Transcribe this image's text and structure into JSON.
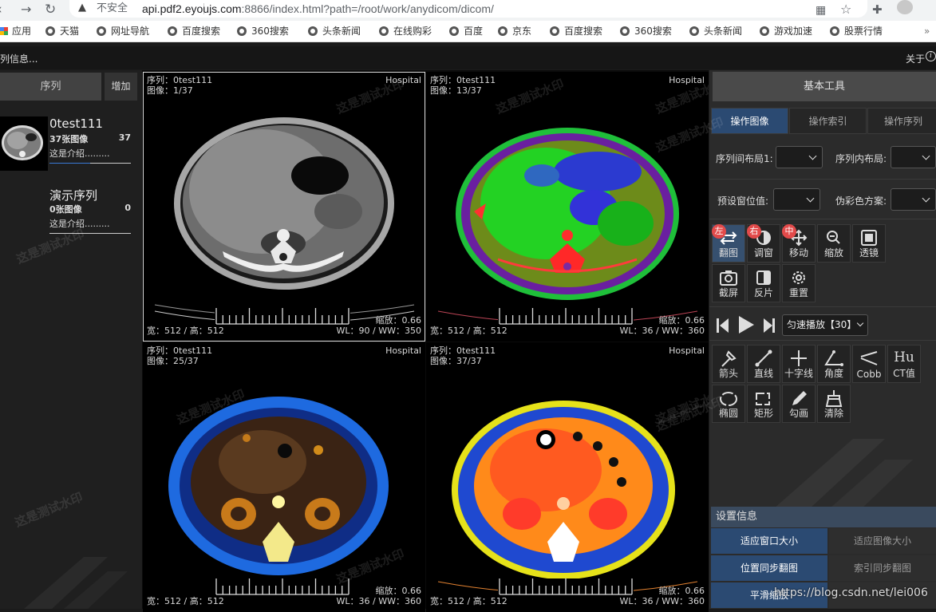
{
  "browser": {
    "security": "不安全",
    "url_host": "api.pdf2.eyoujs.com",
    "url_rest": ":8866/index.html?path=/root/work/anydicom/dicom/",
    "bookmarks": [
      "应用",
      "天猫",
      "网址导航",
      "百度搜索",
      "360搜索",
      "头条新闻",
      "在线购彩",
      "百度",
      "京东",
      "百度搜索",
      "360搜索",
      "头条新闻",
      "游戏加速",
      "股票行情"
    ]
  },
  "appbar": {
    "left_text": "列信息...",
    "right_text": "关于"
  },
  "left": {
    "tab_label": "序列",
    "add_label": "增加",
    "series": [
      {
        "name": "0test111",
        "count": "37张图像",
        "num": "37",
        "intro": "这是介绍.........",
        "progress": 0.5
      },
      {
        "name": "演示序列",
        "count": "0张图像",
        "num": "0",
        "intro": "这是介绍.........",
        "progress": 0
      }
    ]
  },
  "viewports": [
    {
      "series": "序列：0test111",
      "image": "图像：1/37",
      "hospital": "Hospital",
      "zoom": "缩放：0.66",
      "size": "宽：512 / 高：512",
      "wlww": "WL：90 / WW：350",
      "watermark": "这是测试水印"
    },
    {
      "series": "序列：0test111",
      "image": "图像：13/37",
      "hospital": "Hospital",
      "zoom": "缩放：0.66",
      "size": "宽：512 / 高：512",
      "wlww": "WL：36 / WW：360",
      "watermark": "这是测试水印"
    },
    {
      "series": "序列：0test111",
      "image": "图像：25/37",
      "hospital": "Hospital",
      "zoom": "缩放：0.66",
      "size": "宽：512 / 高：512",
      "wlww": "WL：36 / WW：360",
      "watermark": "这是测试水印"
    },
    {
      "series": "序列：0test111",
      "image": "图像：37/37",
      "hospital": "Hospital",
      "zoom": "缩放：0.66",
      "size": "宽：512 / 高：512",
      "wlww": "WL：36 / WW：360",
      "watermark": "这是测试水印"
    }
  ],
  "right": {
    "header": "基本工具",
    "tabs": [
      "操作图像",
      "操作索引",
      "操作序列"
    ],
    "labels": {
      "series_layout": "序列间布局1:",
      "inner_layout": "序列内布局:",
      "preset_wl": "预设窗位值:",
      "pseudo_color": "伪彩色方案:"
    },
    "tools1": [
      {
        "label": "翻图",
        "badge": "左"
      },
      {
        "label": "调窗",
        "badge": "右"
      },
      {
        "label": "移动",
        "badge": "中"
      },
      {
        "label": "缩放",
        "badge": ""
      },
      {
        "label": "透镜",
        "badge": ""
      },
      {
        "label": "截屏",
        "badge": ""
      },
      {
        "label": "反片",
        "badge": ""
      },
      {
        "label": "重置",
        "badge": ""
      }
    ],
    "play_mode": "匀速播放【30】",
    "tools2": [
      "箭头",
      "直线",
      "十字线",
      "角度",
      "Cobb",
      "CT值",
      "椭圆",
      "矩形",
      "勾画",
      "清除"
    ],
    "hu_glyph": "Hu",
    "settings_title": "设置信息",
    "settings": [
      [
        "适应窗口大小",
        "适应图像大小"
      ],
      [
        "位置同步翻图",
        "索引同步翻图"
      ],
      [
        "平滑缩放",
        ""
      ]
    ]
  },
  "watermark_url": "https://blog.csdn.net/lei006"
}
